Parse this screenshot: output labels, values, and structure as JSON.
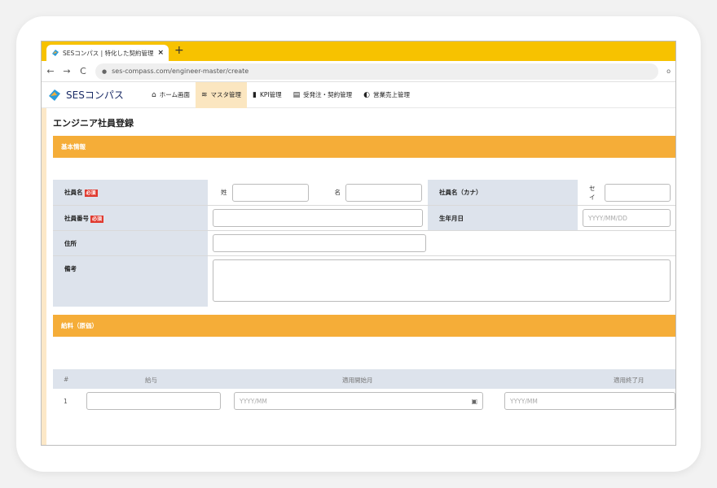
{
  "tab": {
    "title": "SESコンパス | 特化した契約管理・営業",
    "close": "×",
    "new_tab": "+"
  },
  "browser": {
    "back": "←",
    "forward": "→",
    "reload": "C",
    "url": "ses-compass.com/engineer-master/create",
    "ext": "o"
  },
  "app": {
    "logo_text": "SESコンパス",
    "nav": [
      {
        "icon": "home-icon",
        "glyph": "⌂",
        "label": "ホーム画面"
      },
      {
        "icon": "database-icon",
        "glyph": "≋",
        "label": "マスタ管理"
      },
      {
        "icon": "chart-icon",
        "glyph": "▮",
        "label": "KPI管理"
      },
      {
        "icon": "document-icon",
        "glyph": "▤",
        "label": "受発注・契約管理"
      },
      {
        "icon": "pie-chart-icon",
        "glyph": "◐",
        "label": "営業売上管理"
      }
    ]
  },
  "page": {
    "title": "エンジニア社員登録",
    "section_basic": "基本情報",
    "section_salary": "給料（原価）",
    "required_badge": "必須",
    "fields": {
      "name_label": "社員名",
      "last_name": "姓",
      "first_name": "名",
      "name_kana_label": "社員名（カナ）",
      "kana_sei": "セイ",
      "employee_no_label": "社員番号",
      "birthdate_label": "生年月日",
      "birthdate_placeholder": "YYYY/MM/DD",
      "address_label": "住所",
      "notes_label": "備考"
    },
    "salary_table": {
      "headers": [
        "#",
        "給与",
        "適用開始月",
        "適用終了月"
      ],
      "rows": [
        {
          "index": "1",
          "start_placeholder": "YYYY/MM",
          "end_placeholder": "YYYY/MM"
        }
      ]
    }
  }
}
